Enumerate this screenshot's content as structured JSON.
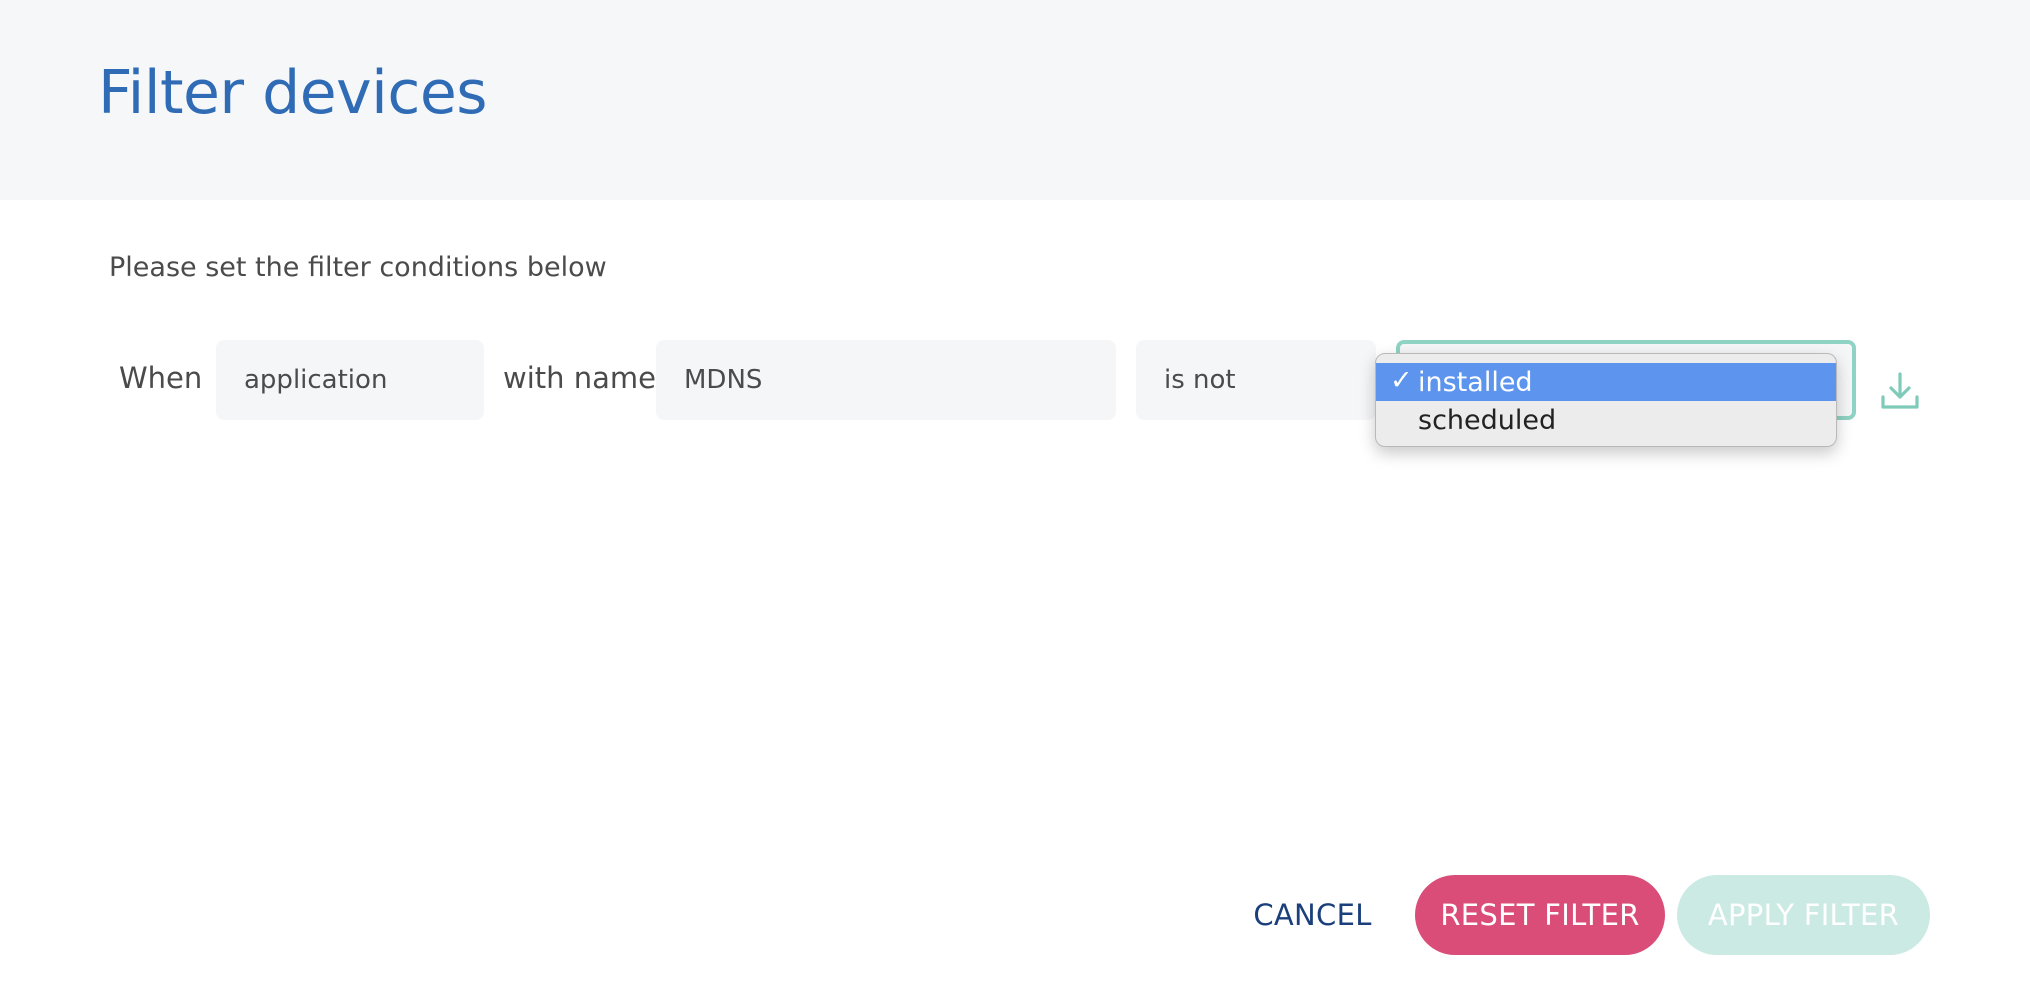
{
  "header": {
    "title": "Filter devices"
  },
  "instructions": "Please set the filter conditions below",
  "condition": {
    "when_label": "When",
    "scope_value": "application",
    "with_name_label": "with name",
    "name_value": "MDNS",
    "operator_value": "is not",
    "status_dropdown": {
      "selected": "installed",
      "check_glyph": "✓",
      "options": [
        "installed",
        "scheduled"
      ]
    },
    "save_icon": "download-icon",
    "accent_color": "#8fd3c4"
  },
  "actions": {
    "cancel_label": "CANCEL",
    "reset_label": "RESET FILTER",
    "apply_label": "APPLY FILTER"
  },
  "colors": {
    "title": "#2f6cb5",
    "reset_button": "#db4d79",
    "apply_button_disabled": "#cbeae4",
    "dropdown_highlight": "#5c94ee"
  }
}
